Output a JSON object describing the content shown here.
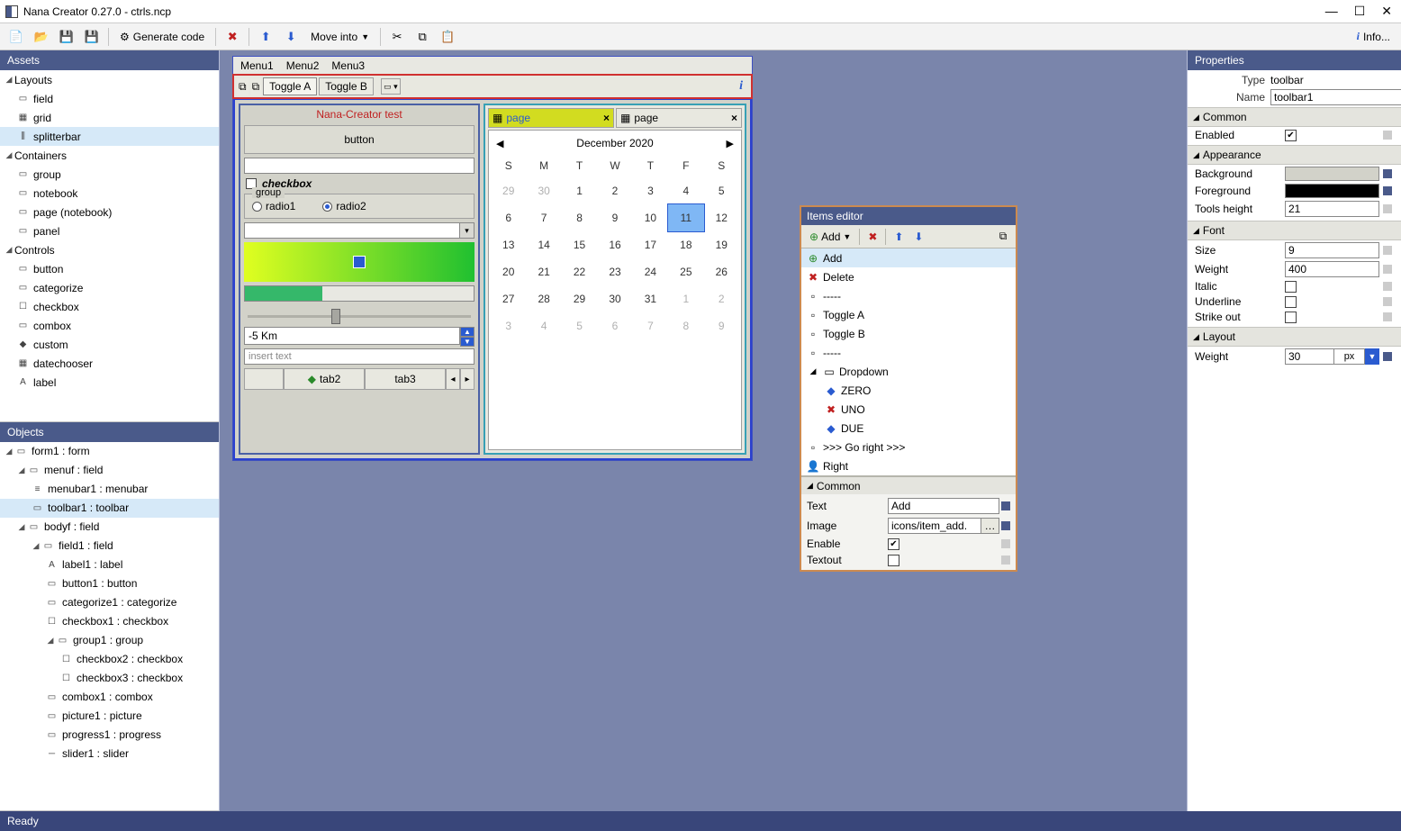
{
  "titlebar": {
    "text": "Nana Creator 0.27.0 - ctrls.ncp"
  },
  "main_toolbar": {
    "generate": "Generate code",
    "move_into": "Move into",
    "info": "Info..."
  },
  "assets": {
    "title": "Assets",
    "layouts": {
      "header": "Layouts",
      "items": [
        "field",
        "grid",
        "splitterbar"
      ]
    },
    "containers": {
      "header": "Containers",
      "items": [
        "group",
        "notebook",
        "page (notebook)",
        "panel"
      ]
    },
    "controls": {
      "header": "Controls",
      "items": [
        "button",
        "categorize",
        "checkbox",
        "combox",
        "custom",
        "datechooser",
        "label"
      ]
    }
  },
  "objects": {
    "title": "Objects",
    "items": [
      "form1 : form",
      "menuf : field",
      "menubar1 : menubar",
      "toolbar1 : toolbar",
      "bodyf : field",
      "field1 : field",
      "label1 : label",
      "button1 : button",
      "categorize1 : categorize",
      "checkbox1 : checkbox",
      "group1 : group",
      "checkbox2 : checkbox",
      "checkbox3 : checkbox",
      "combox1 : combox",
      "picture1 : picture",
      "progress1 : progress",
      "slider1 : slider"
    ]
  },
  "design": {
    "menus": [
      "Menu1",
      "Menu2",
      "Menu3"
    ],
    "toggles": [
      "Toggle A",
      "Toggle B"
    ],
    "title": "Nana-Creator test",
    "button": "button",
    "checkbox": "checkbox",
    "group": "group",
    "radio1": "radio1",
    "radio2": "radio2",
    "spin": "-5 Km",
    "placeholder": "insert text",
    "tabs": [
      "tab2",
      "tab3"
    ],
    "pages": [
      "page",
      "page"
    ],
    "calendar": {
      "month": "December  2020",
      "dow": [
        "S",
        "M",
        "T",
        "W",
        "T",
        "F",
        "S"
      ],
      "leading": [
        29,
        30
      ],
      "days": [
        1,
        2,
        3,
        4,
        5,
        6,
        7,
        8,
        9,
        10,
        11,
        12,
        13,
        14,
        15,
        16,
        17,
        18,
        19,
        20,
        21,
        22,
        23,
        24,
        25,
        26,
        27,
        28,
        29,
        30,
        31
      ],
      "trailing": [
        1,
        2,
        3,
        4,
        5,
        6,
        7,
        8,
        9
      ],
      "today": 11
    }
  },
  "items_editor": {
    "title": "Items editor",
    "add": "Add",
    "list": [
      "Add",
      "Delete",
      "-----",
      "Toggle A",
      "Toggle B",
      "-----",
      "Dropdown",
      "ZERO",
      "UNO",
      "DUE",
      ">>>   Go right   >>>",
      "Right"
    ],
    "common": "Common",
    "props": {
      "text_label": "Text",
      "text_value": "Add",
      "image_label": "Image",
      "image_value": "icons/item_add.",
      "enable_label": "Enable",
      "enable_value": true,
      "textout_label": "Textout",
      "textout_value": false
    }
  },
  "properties": {
    "title": "Properties",
    "type_label": "Type",
    "type_value": "toolbar",
    "name_label": "Name",
    "name_value": "toolbar1",
    "sections": {
      "common": "Common",
      "appearance": "Appearance",
      "font": "Font",
      "layout": "Layout"
    },
    "enabled_label": "Enabled",
    "enabled_value": true,
    "background_label": "Background",
    "background_color": "#d2d2c9",
    "foreground_label": "Foreground",
    "foreground_color": "#000000",
    "toolsheight_label": "Tools height",
    "toolsheight_value": "21",
    "size_label": "Size",
    "size_value": "9",
    "weight_label": "Weight",
    "weight_value": "400",
    "italic_label": "Italic",
    "underline_label": "Underline",
    "strikeout_label": "Strike out",
    "lweight_label": "Weight",
    "lweight_value": "30",
    "lweight_unit": "px"
  },
  "status": {
    "text": "Ready"
  }
}
